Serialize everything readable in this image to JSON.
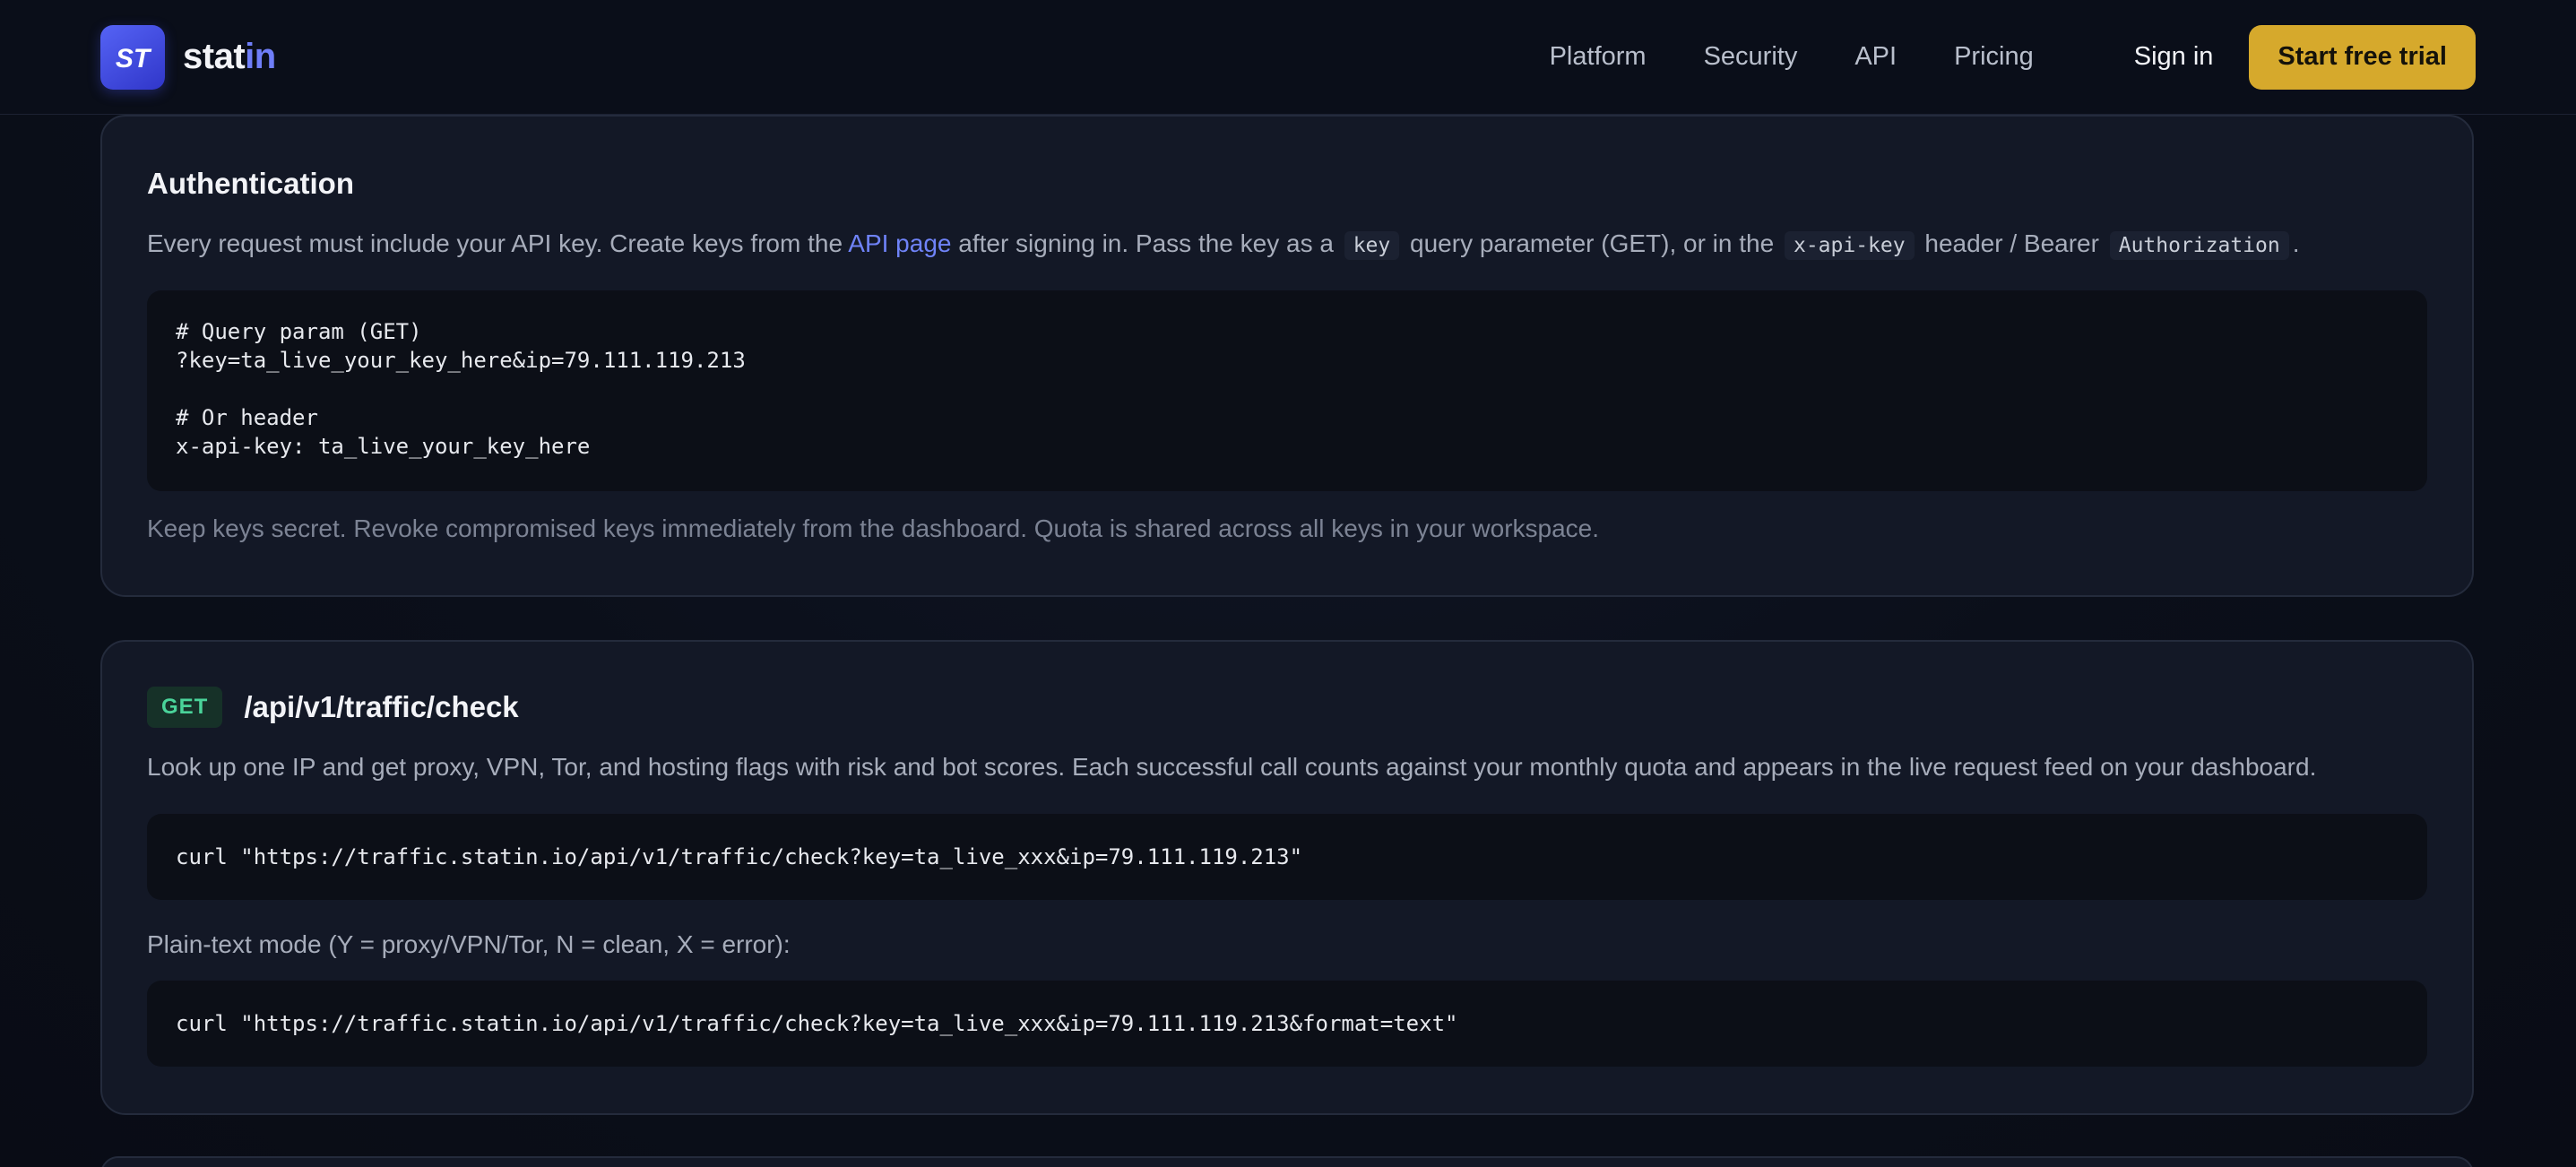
{
  "header": {
    "logo_mark_text": "ST",
    "brand_prefix": "stat",
    "brand_suffix": "in",
    "nav": [
      "Platform",
      "Security",
      "API",
      "Pricing"
    ],
    "signin": "Sign in",
    "cta": "Start free trial",
    "colors": {
      "accent": "#6f7ef8",
      "cta": "#d6a92c"
    }
  },
  "auth": {
    "title": "Authentication",
    "p1_before_link": "Every request must include your API key. Create keys from the ",
    "p1_link": "API page",
    "p1_after_link": " after signing in. Pass the key as a ",
    "p1_code1": "key",
    "p1_mid": " query parameter (GET), or in the ",
    "p1_code2": "x-api-key",
    "p1_mid2": " header / Bearer ",
    "p1_code3": "Authorization",
    "p1_end": ".",
    "code": "# Query param (GET)\n?key=ta_live_your_key_here&ip=79.111.119.213\n\n# Or header\nx-api-key: ta_live_your_key_here",
    "note": "Keep keys secret. Revoke compromised keys immediately from the dashboard. Quota is shared across all keys in your workspace."
  },
  "check": {
    "method": "GET",
    "path": "/api/v1/traffic/check",
    "description": "Look up one IP and get proxy, VPN, Tor, and hosting flags with risk and bot scores. Each successful call counts against your monthly quota and appears in the live request feed on your dashboard.",
    "curl": "curl \"https://traffic.statin.io/api/v1/traffic/check?key=ta_live_xxx&ip=79.111.119.213\"",
    "plain_label": "Plain-text mode (Y = proxy/VPN/Tor, N = clean, X = error):",
    "curl_text": "curl \"https://traffic.statin.io/api/v1/traffic/check?key=ta_live_xxx&ip=79.111.119.213&format=text\""
  }
}
